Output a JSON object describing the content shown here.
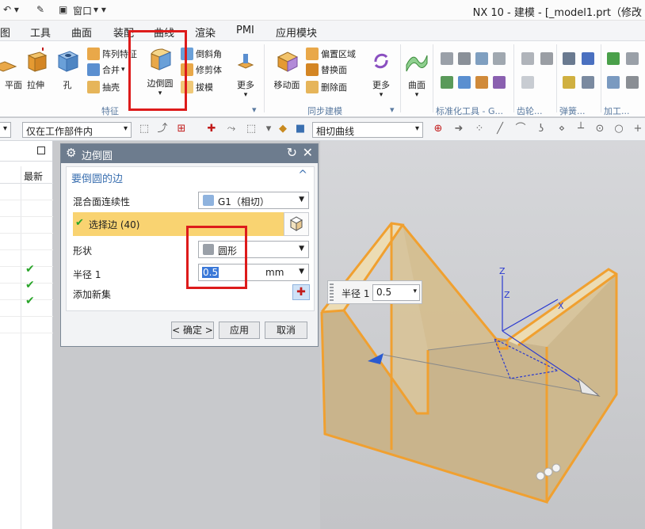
{
  "titlebar": {
    "window_menu": "窗口",
    "title": "NX 10 - 建模 - [_model1.prt（修改"
  },
  "menubar": {
    "items": [
      "图",
      "工具",
      "曲面",
      "装配",
      "曲线",
      "渲染",
      "PMI",
      "应用模块"
    ]
  },
  "ribbon": {
    "big": {
      "plane": "平面",
      "extrude": "拉伸",
      "hole": "孔",
      "edge_blend": "边倒圆",
      "more1": "更多",
      "move_face": "移动面",
      "more2": "更多",
      "surface": "曲面"
    },
    "feature_small": [
      "阵列特征",
      "合并",
      "抽壳"
    ],
    "feature_small2": [
      "倒斜角",
      "修剪体",
      "拔模"
    ],
    "sync_small": [
      "偏置区域",
      "替换面",
      "删除面"
    ],
    "groups": {
      "feature": "特征",
      "sync": "同步建模",
      "std": "标准化工具 - G...",
      "gear": "齿轮...",
      "spring": "弹簧...",
      "machining": "加工..."
    }
  },
  "selection_bar": {
    "scope": "仅在工作部件内",
    "curve_rule": "相切曲线"
  },
  "navigator": {
    "column_latest": "最新",
    "checks": [
      "✔",
      "✔",
      "✔"
    ]
  },
  "dialog": {
    "title": "边倒圆",
    "section_title": "要倒圆的边",
    "continuity_label": "混合面连续性",
    "continuity_value": "G1（相切）",
    "select_edge": "选择边 (40)",
    "shape_label": "形状",
    "shape_value": "圆形",
    "radius_label": "半径 1",
    "radius_value": "0.5",
    "radius_unit": "mm",
    "add_set_label": "添加新集",
    "ok": "< 确定 >",
    "apply": "应用",
    "cancel": "取消"
  },
  "float_radius": {
    "label": "半径 1",
    "value": "0.5"
  },
  "colors": {
    "highlight_edges": "#f0a030",
    "part_fill": "#dcc8a0",
    "dialog_header": "#6d7c8e",
    "selected_row": "#f9d371",
    "annotation_red": "#dd1b1b"
  }
}
